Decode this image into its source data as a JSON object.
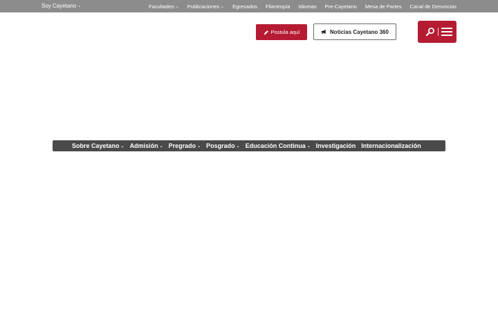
{
  "topbar": {
    "brand": "Soy Cayetano",
    "links": [
      {
        "label": "Facultades",
        "dropdown": true
      },
      {
        "label": "Publicaciones",
        "dropdown": true
      },
      {
        "label": "Egresados",
        "dropdown": false
      },
      {
        "label": "Filantropía",
        "dropdown": false
      },
      {
        "label": "Idiomas",
        "dropdown": false
      },
      {
        "label": "Pre-Cayetano",
        "dropdown": false
      },
      {
        "label": "Mesa de Partes",
        "dropdown": false
      },
      {
        "label": "Canal de Denuncias",
        "dropdown": false
      }
    ]
  },
  "header": {
    "postula_label": "Postula aquí",
    "noticias_label": "Noticias Cayetano 360"
  },
  "mainnav": {
    "items": [
      {
        "label": "Sobre Cayetano",
        "dropdown": true
      },
      {
        "label": "Admisión",
        "dropdown": true
      },
      {
        "label": "Pregrado",
        "dropdown": true
      },
      {
        "label": "Posgrado",
        "dropdown": true
      },
      {
        "label": "Educación Continua",
        "dropdown": true
      },
      {
        "label": "Investigación",
        "dropdown": false
      },
      {
        "label": "Internacionalización",
        "dropdown": false
      }
    ]
  },
  "colors": {
    "topbar": "#8c8c8c",
    "brand_red": "#b51c33",
    "nav_bg": "#4a4a4a"
  },
  "icons": {
    "chevron": "chevron-down-icon",
    "postula": "pencil-icon",
    "noticias": "megaphone-icon",
    "search": "search-icon",
    "menu": "hamburger-icon"
  }
}
